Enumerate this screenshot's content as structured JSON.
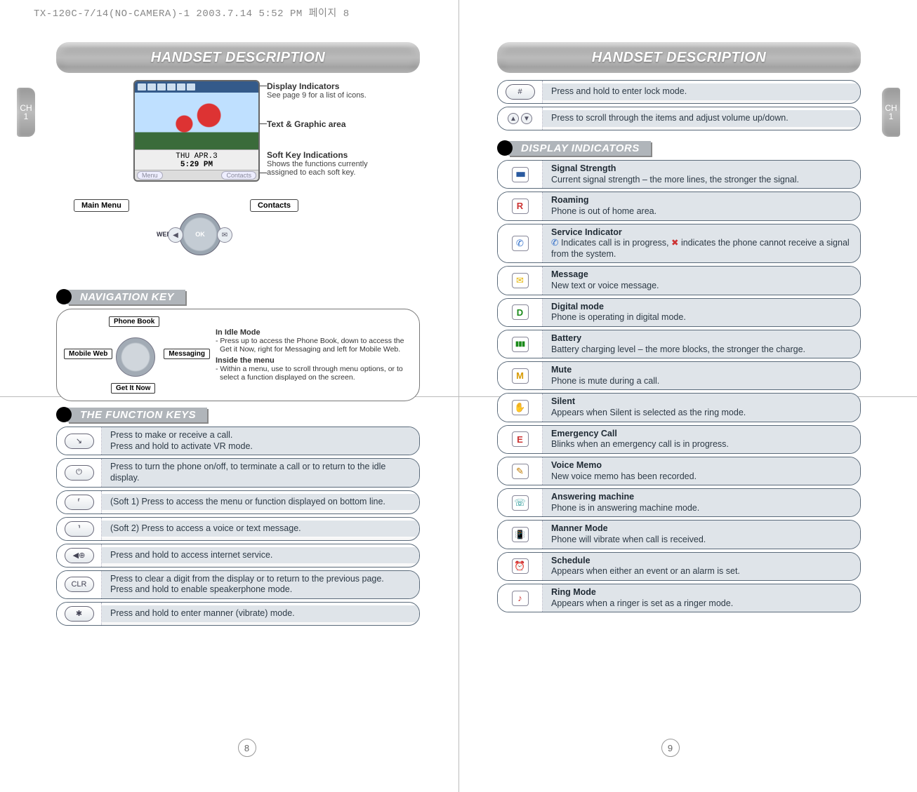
{
  "meta": {
    "header_text": "TX-120C-7/14(NO-CAMERA)-1  2003.7.14 5:52 PM 페이지 8"
  },
  "left": {
    "title": "HANDSET DESCRIPTION",
    "side_tab": {
      "ch": "CH",
      "num": "1"
    },
    "page_num": "8",
    "screen": {
      "date": "THU APR.3",
      "time": "5:29 PM",
      "soft_left": "Menu",
      "soft_right": "Contacts"
    },
    "callouts": {
      "disp_ind_t": "Display Indicators",
      "disp_ind_d": "See page 9 for a list of icons.",
      "text_area_t": "Text & Graphic area",
      "soft_key_t": "Soft Key Indications",
      "soft_key_d1": "Shows the functions currently",
      "soft_key_d2": "assigned to each soft key."
    },
    "labels": {
      "main_menu": "Main Menu",
      "contacts": "Contacts",
      "web": "WEB"
    },
    "nav_section": "NAVIGATION KEY",
    "nav_labels": {
      "up": "Phone Book",
      "down": "Get It Now",
      "left": "Mobile Web",
      "right": "Messaging"
    },
    "nav_desc": {
      "idle_t": "In Idle Mode",
      "idle_d": "- Press up to access the Phone Book, down to access the Get it Now, right for Messaging and left for Mobile Web.",
      "menu_t": "Inside the menu",
      "menu_d": "- Within a menu, use to scroll through menu options, or to select a function displayed on the screen."
    },
    "func_section": "THE FUNCTION KEYS",
    "func_rows": [
      {
        "key": "↘",
        "text": "Press to make or receive a call.\nPress and hold to activate VR mode."
      },
      {
        "key": "⏻",
        "text": "Press to turn the phone on/off, to terminate a call or to return to the idle display."
      },
      {
        "key": "⸢",
        "text": "(Soft 1) Press to access the menu or function displayed on bottom line."
      },
      {
        "key": "⸣",
        "text": "(Soft 2) Press to access a voice or text message."
      },
      {
        "key": "◀⊕",
        "text": "Press and hold to access internet service."
      },
      {
        "key": "CLR",
        "text": "Press to clear a digit from the display or to return to the previous page.\nPress and hold to enable speakerphone mode."
      },
      {
        "key": "✱",
        "text": "Press and hold to enter manner (vibrate) mode."
      }
    ]
  },
  "right": {
    "title": "HANDSET DESCRIPTION",
    "side_tab": {
      "ch": "CH",
      "num": "1"
    },
    "page_num": "9",
    "top_rows": [
      {
        "key": "#",
        "text": "Press and hold to enter lock mode."
      },
      {
        "key": "▲▼",
        "text": "Press to scroll through the items and adjust volume up/down."
      }
    ],
    "ind_section": "DISPLAY INDICATORS",
    "indicators": [
      {
        "ico": "signal",
        "t": "Signal Strength",
        "d": "Current signal strength – the more lines, the stronger the signal."
      },
      {
        "ico": "r",
        "t": "Roaming",
        "d": "Phone is out of home area."
      },
      {
        "ico": "phone",
        "t": "Service Indicator",
        "d": "Indicates call is in progress,  indicates the phone cannot receive a signal from the system.",
        "leading_icon": true
      },
      {
        "ico": "msg",
        "t": "Message",
        "d": "New text or voice message."
      },
      {
        "ico": "d",
        "t": "Digital mode",
        "d": "Phone is operating in digital mode."
      },
      {
        "ico": "batt",
        "t": "Battery",
        "d": "Battery charging level – the more blocks, the stronger the charge."
      },
      {
        "ico": "m",
        "t": "Mute",
        "d": "Phone is mute during a call."
      },
      {
        "ico": "hand",
        "t": "Silent",
        "d": "Appears when Silent is selected as the ring mode."
      },
      {
        "ico": "e",
        "t": "Emergency Call",
        "d": "Blinks when an emergency call is in progress."
      },
      {
        "ico": "memo",
        "t": "Voice Memo",
        "d": "New voice memo has been recorded."
      },
      {
        "ico": "ans",
        "t": "Answering machine",
        "d": "Phone is in answering machine mode."
      },
      {
        "ico": "vib",
        "t": "Manner Mode",
        "d": "Phone will vibrate when call is received."
      },
      {
        "ico": "sched",
        "t": "Schedule",
        "d": "Appears when either an event or an alarm is set."
      },
      {
        "ico": "ring",
        "t": "Ring Mode",
        "d": "Appears when a ringer is set as a ringer mode."
      }
    ]
  }
}
